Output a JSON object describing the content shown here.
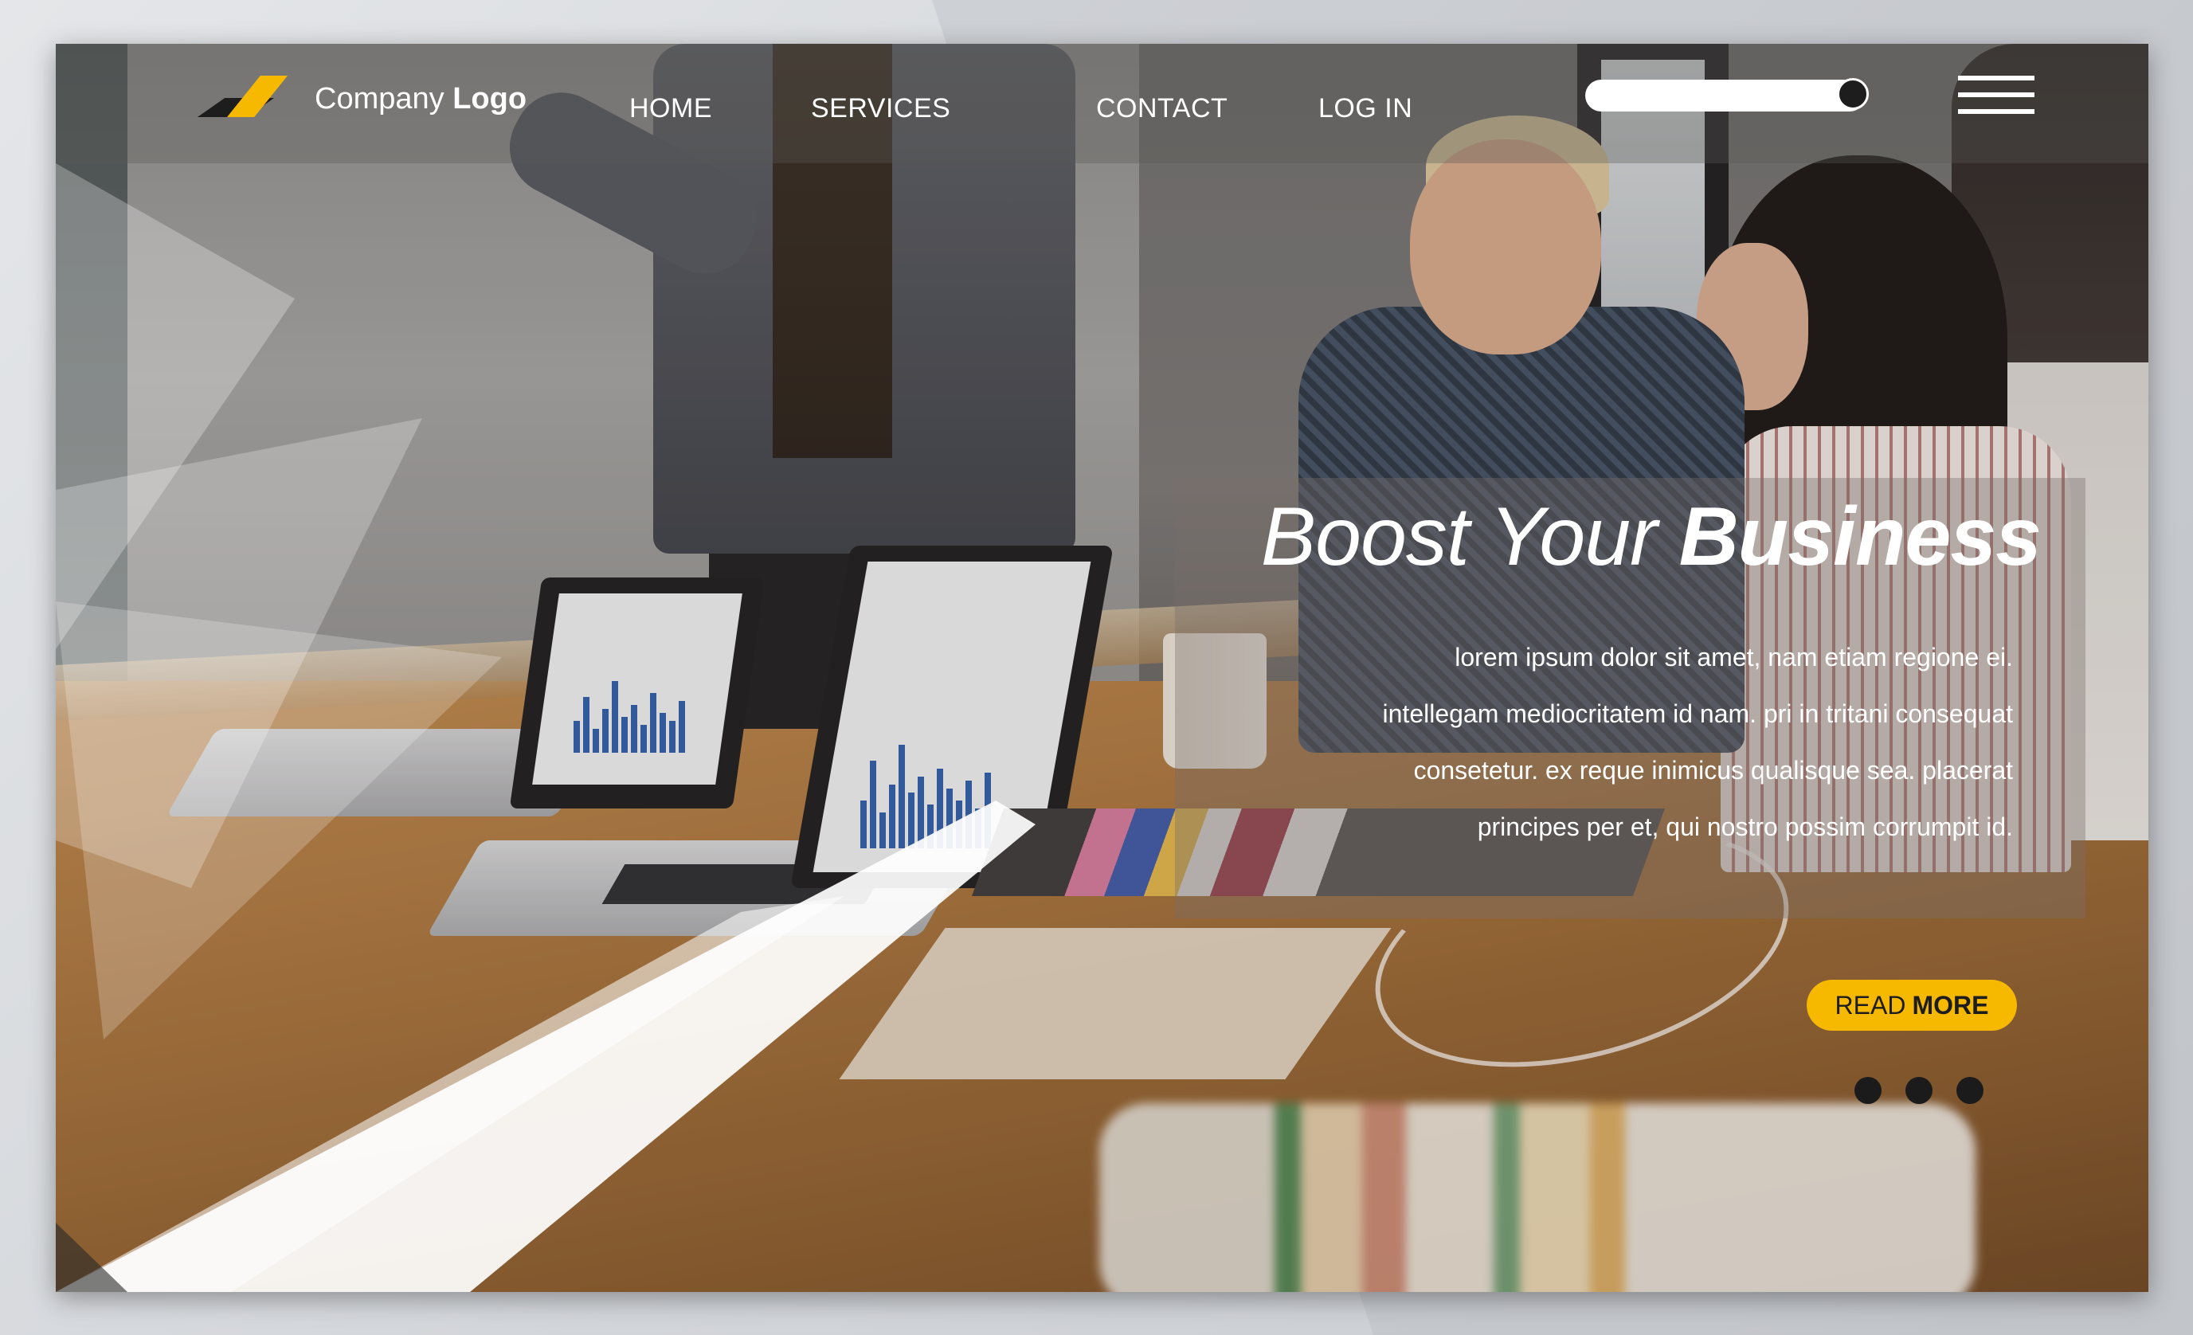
{
  "brand": {
    "name_regular": "Company",
    "name_bold": "Logo",
    "accent_color": "#f6b900",
    "dark_color": "#1d1d1d"
  },
  "nav": {
    "items": [
      {
        "label": "HOME"
      },
      {
        "label": "SERVICES"
      },
      {
        "label": "CONTACT"
      },
      {
        "label": "LOG IN"
      }
    ]
  },
  "search": {
    "icon": "search-slider-knob"
  },
  "menu": {
    "icon": "hamburger-menu-icon"
  },
  "hero": {
    "title_light": "Boost Your",
    "title_bold": "Business",
    "body_lines": [
      "lorem ipsum dolor sit amet, nam etiam regione ei.",
      "intellegam mediocritatem id nam. pri in tritani consequat",
      "consetetur. ex reque inimicus qualisque sea. placerat",
      "principes per et, qui nostro possim corrumpit id."
    ],
    "cta_regular": "READ",
    "cta_bold": "MORE"
  },
  "slider": {
    "dot_count": 3
  }
}
